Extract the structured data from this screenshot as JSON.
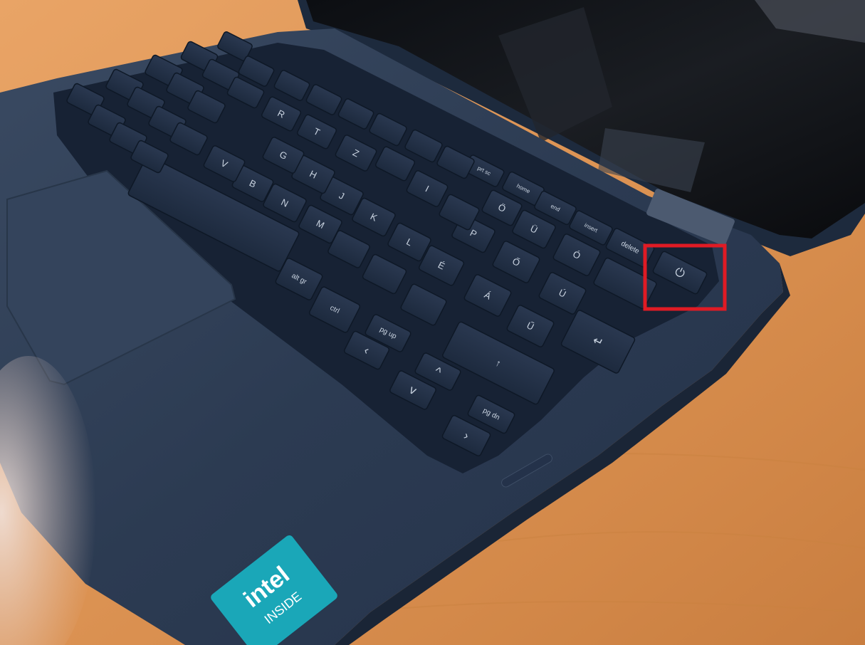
{
  "photo": {
    "subject": "laptop keyboard with power button highlighted",
    "highlight_color": "#e01b24",
    "desk_color": "#d98f4f",
    "chassis_color": "#2b3a50",
    "badge_color": "#1aa7b8",
    "badge": {
      "line1": "intel",
      "line2": "INSIDE"
    }
  },
  "keys": {
    "altgr": "alt gr",
    "ctrl": "ctrl",
    "pgup": "pg up",
    "pgdn": "pg dn",
    "delete": "delete",
    "insert": "insert",
    "end": "end",
    "home": "home",
    "prtsc": "prt sc",
    "power": "⏻",
    "left_arrow": "‹",
    "right_arrow": "›",
    "up_arrow": "^",
    "down_arrow": "v",
    "shift_arrow": "↑",
    "enter": "↵",
    "row_o": "Ö",
    "row_u": "Ü",
    "row_ó": "Ó",
    "row_p": "P",
    "row_ő": "Ő",
    "row_ú": "Ú",
    "row_ű": "Ű",
    "row_é": "É",
    "row_á": "Á",
    "row_l": "L",
    "row_k": "K",
    "row_j": "J",
    "row_h": "H",
    "row_g": "G",
    "row_m": "M",
    "row_n": "N",
    "row_b": "B",
    "row_v": "V",
    "row_i": "I",
    "row_z": "Z",
    "row_t": "T",
    "row_r": "R"
  }
}
